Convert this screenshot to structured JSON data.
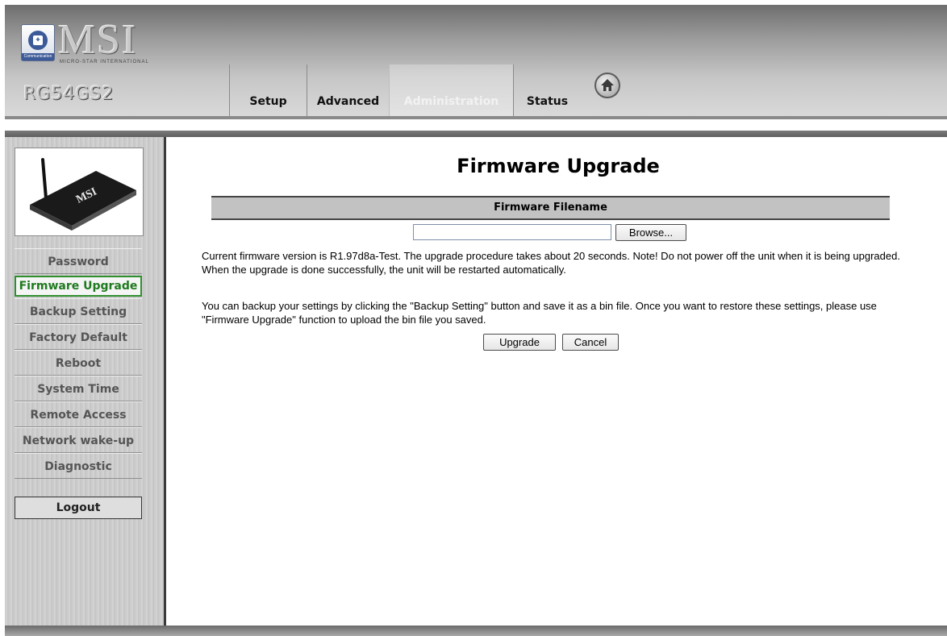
{
  "header": {
    "logo_text": "MSI",
    "logo_tagline": "MICRO-STAR INTERNATIONAL",
    "logo_emblem_sub": "Communication",
    "model": "RG54GS2",
    "tabs": [
      {
        "label": "Setup"
      },
      {
        "label": "Advanced"
      },
      {
        "label": "Administration",
        "active": true
      },
      {
        "label": "Status"
      }
    ],
    "home_icon": "home-icon"
  },
  "sidebar": {
    "product_image_label": "MSI",
    "items": [
      {
        "label": "Password"
      },
      {
        "label": "Firmware Upgrade",
        "active": true
      },
      {
        "label": "Backup Setting"
      },
      {
        "label": "Factory Default"
      },
      {
        "label": "Reboot"
      },
      {
        "label": "System Time"
      },
      {
        "label": "Remote Access"
      },
      {
        "label": "Network wake-up"
      },
      {
        "label": "Diagnostic"
      }
    ],
    "logout_label": "Logout"
  },
  "main": {
    "title": "Firmware Upgrade",
    "section_header": "Firmware Filename",
    "file_value": "",
    "browse_label": "Browse...",
    "info_text": "Current firmware version is R1.97d8a-Test. The upgrade procedure takes about 20 seconds. Note! Do not power off the unit when it is being upgraded. When the upgrade is done successfully, the unit will be restarted automatically.",
    "backup_text": "You can backup your settings by clicking the \"Backup Setting\" button and save it as a bin file. Once you want to restore these settings, please use \"Firmware Upgrade\" function to upload the bin file you saved.",
    "upgrade_label": "Upgrade",
    "cancel_label": "Cancel"
  },
  "colors": {
    "active_menu_text": "#1f7a1f",
    "active_menu_border": "#2f8f2f",
    "section_header_bg": "#c2c2c2"
  }
}
